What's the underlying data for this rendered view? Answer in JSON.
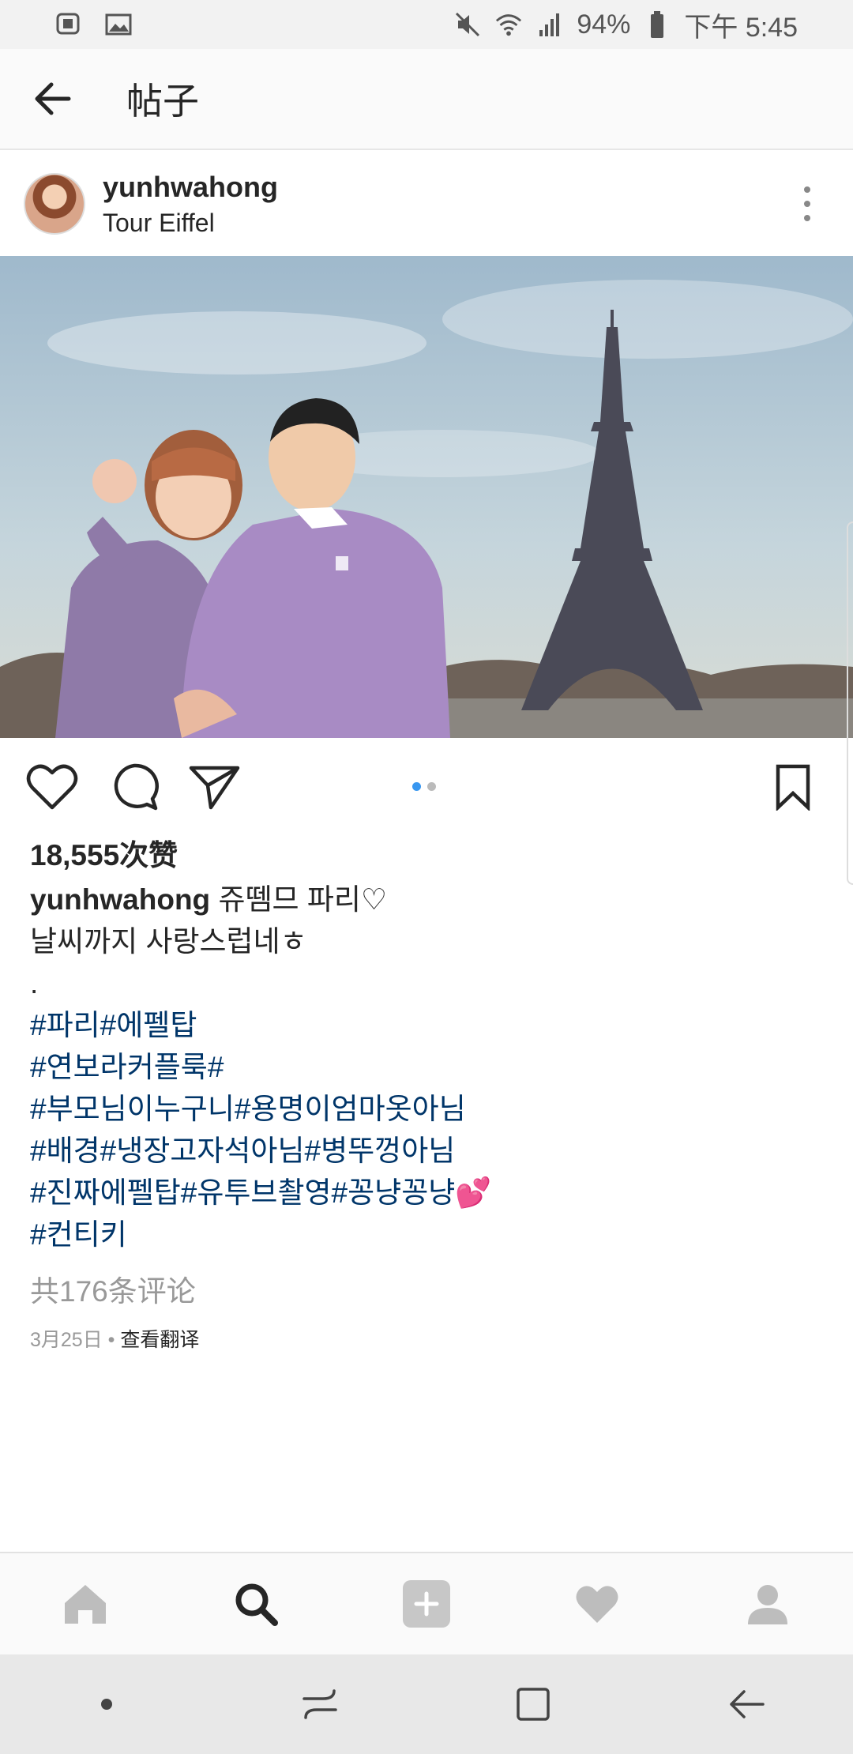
{
  "status_bar": {
    "battery": "94%",
    "time": "下午 5:45",
    "icons": [
      "app-notification-icon",
      "image-notification-icon",
      "mute-icon",
      "wifi-icon",
      "signal-icon",
      "battery-icon"
    ]
  },
  "header": {
    "title": "帖子",
    "back_icon": "arrow-left-icon"
  },
  "post": {
    "username": "yunhwahong",
    "location": "Tour Eiffel",
    "likes": "18,555次赞",
    "caption_user": "yunhwahong",
    "caption_line1": "쥬뗌므 파리♡",
    "caption_line2": "날씨까지 사랑스럽네ㅎ",
    "caption_dot": ".",
    "hashtags": [
      "#파리#에펠탑",
      "#연보라커플룩#",
      "#부모님이누구니#용명이엄마옷아님",
      "#배경#냉장고자석아님#병뚜껑아님",
      "#진짜에펠탑#유투브촬영#꽁냥꽁냥💕",
      "#컨티키"
    ],
    "comments": "共176条评论",
    "date": "3月25日",
    "separator": " • ",
    "translate": "查看翻译",
    "image_count": 2,
    "active_image": 1
  },
  "actions": {
    "icons": [
      "heart-icon",
      "comment-icon",
      "share-icon",
      "bookmark-icon"
    ]
  },
  "bottom_nav": {
    "items": [
      "home-icon",
      "search-icon",
      "add-icon",
      "activity-heart-icon",
      "profile-icon"
    ],
    "active": "search-icon"
  },
  "colors": {
    "accent_blue": "#3897f0",
    "hashtag": "#003569",
    "muted": "#999999"
  }
}
